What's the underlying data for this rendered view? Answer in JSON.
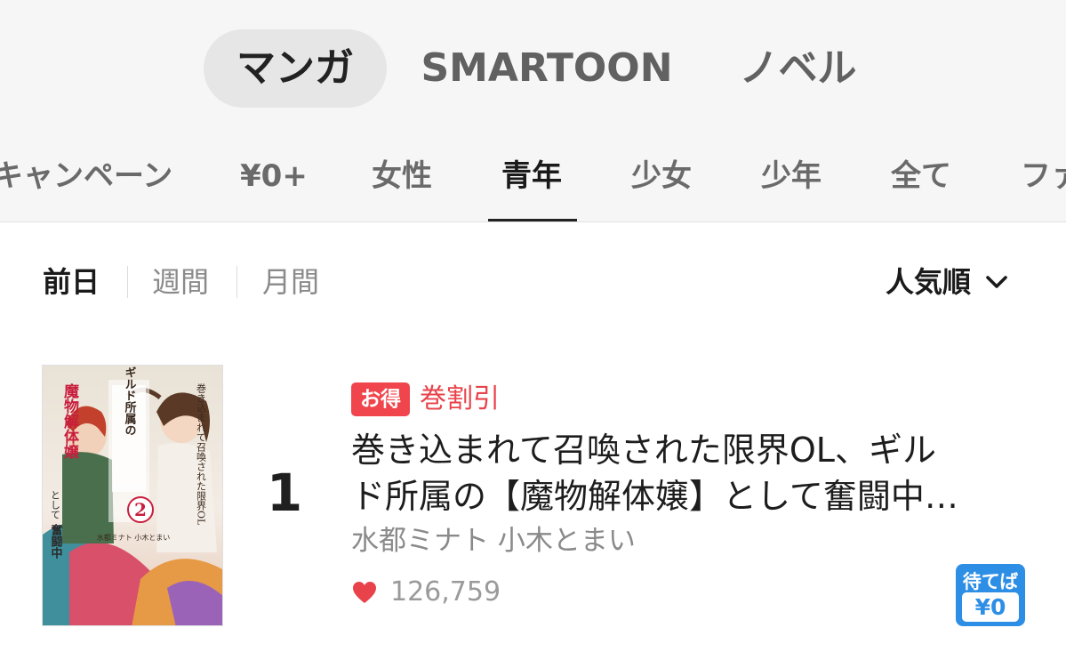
{
  "type_tabs": [
    {
      "label": "マンガ",
      "active": true
    },
    {
      "label": "SMARTOON",
      "active": false
    },
    {
      "label": "ノベル",
      "active": false
    }
  ],
  "genre_tabs": [
    {
      "label": "キャンペーン",
      "active": false
    },
    {
      "label": "¥0+",
      "active": false
    },
    {
      "label": "女性",
      "active": false
    },
    {
      "label": "青年",
      "active": true
    },
    {
      "label": "少女",
      "active": false
    },
    {
      "label": "少年",
      "active": false
    },
    {
      "label": "全て",
      "active": false
    },
    {
      "label": "ファ",
      "active": false
    }
  ],
  "period_tabs": [
    {
      "label": "前日",
      "active": true
    },
    {
      "label": "週間",
      "active": false
    },
    {
      "label": "月間",
      "active": false
    }
  ],
  "sort": {
    "label": "人気順",
    "icon": "chevron-down-icon"
  },
  "ranking": [
    {
      "rank": "1",
      "badge": "お得",
      "promo": "巻割引",
      "title": "巻き込まれて召喚された限界OL、ギル\nド所属の【魔物解体嬢】として奮闘中…",
      "author": "水都ミナト 小木とまい",
      "likes": "126,759",
      "wait_badge": {
        "label": "待てば",
        "price": "¥0"
      },
      "cover": {
        "vertical_titles": [
          "巻き込まれて召喚された限界OL",
          "ギルド所属の",
          "魔物解体嬢",
          "として",
          "奮闘中"
        ],
        "volume": "2",
        "credits": "水都ミナト 小木とまい"
      }
    }
  ],
  "colors": {
    "accent_red": "#f0454d",
    "accent_blue": "#2d8ee5",
    "heart": "#e8434b"
  }
}
